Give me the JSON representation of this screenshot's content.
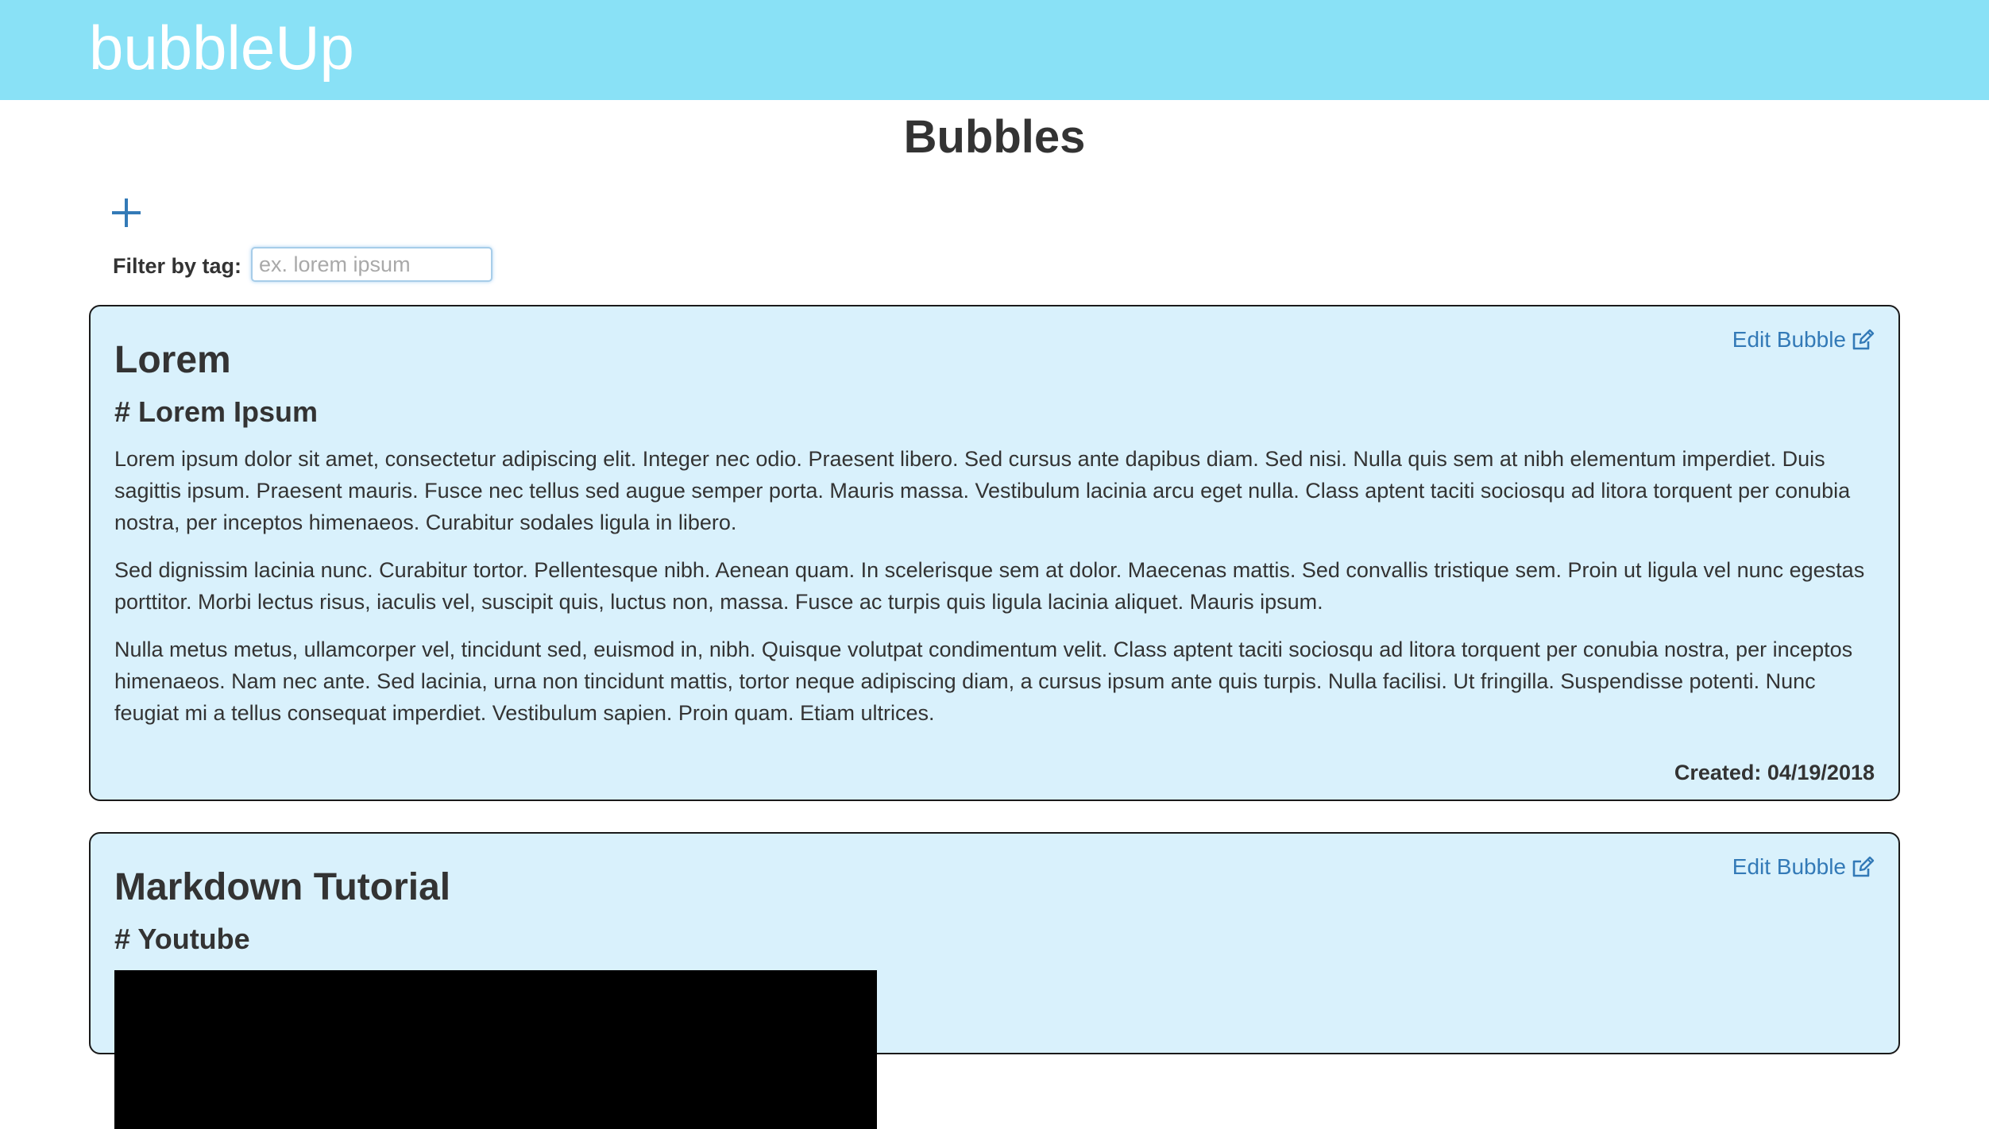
{
  "navbar": {
    "brand": "bubbleUp",
    "background": "#89e1f6"
  },
  "page": {
    "title": "Bubbles"
  },
  "toolbar": {
    "add_icon": "plus-icon",
    "filter_label": "Filter by tag:",
    "filter_placeholder": "ex. lorem ipsum",
    "filter_value": ""
  },
  "bubbles": [
    {
      "title": "Lorem",
      "heading": "# Lorem Ipsum",
      "edit_label": "Edit Bubble",
      "edit_icon": "edit-icon",
      "paragraphs": [
        "Lorem ipsum dolor sit amet, consectetur adipiscing elit. Integer nec odio. Praesent libero. Sed cursus ante dapibus diam. Sed nisi. Nulla quis sem at nibh elementum imperdiet. Duis sagittis ipsum. Praesent mauris. Fusce nec tellus sed augue semper porta. Mauris massa. Vestibulum lacinia arcu eget nulla. Class aptent taciti sociosqu ad litora torquent per conubia nostra, per inceptos himenaeos. Curabitur sodales ligula in libero.",
        "Sed dignissim lacinia nunc. Curabitur tortor. Pellentesque nibh. Aenean quam. In scelerisque sem at dolor. Maecenas mattis. Sed convallis tristique sem. Proin ut ligula vel nunc egestas porttitor. Morbi lectus risus, iaculis vel, suscipit quis, luctus non, massa. Fusce ac turpis quis ligula lacinia aliquet. Mauris ipsum.",
        "Nulla metus metus, ullamcorper vel, tincidunt sed, euismod in, nibh. Quisque volutpat condimentum velit. Class aptent taciti sociosqu ad litora torquent per conubia nostra, per inceptos himenaeos. Nam nec ante. Sed lacinia, urna non tincidunt mattis, tortor neque adipiscing diam, a cursus ipsum ante quis turpis. Nulla facilisi. Ut fringilla. Suspendisse potenti. Nunc feugiat mi a tellus consequat imperdiet. Vestibulum sapien. Proin quam. Etiam ultrices."
      ],
      "created": "Created: 04/19/2018"
    },
    {
      "title": "Markdown Tutorial",
      "heading": "# Youtube",
      "edit_label": "Edit Bubble",
      "edit_icon": "edit-icon"
    }
  ],
  "colors": {
    "card_background": "#d9f1fc",
    "link": "#337ab7",
    "text": "#333333"
  }
}
